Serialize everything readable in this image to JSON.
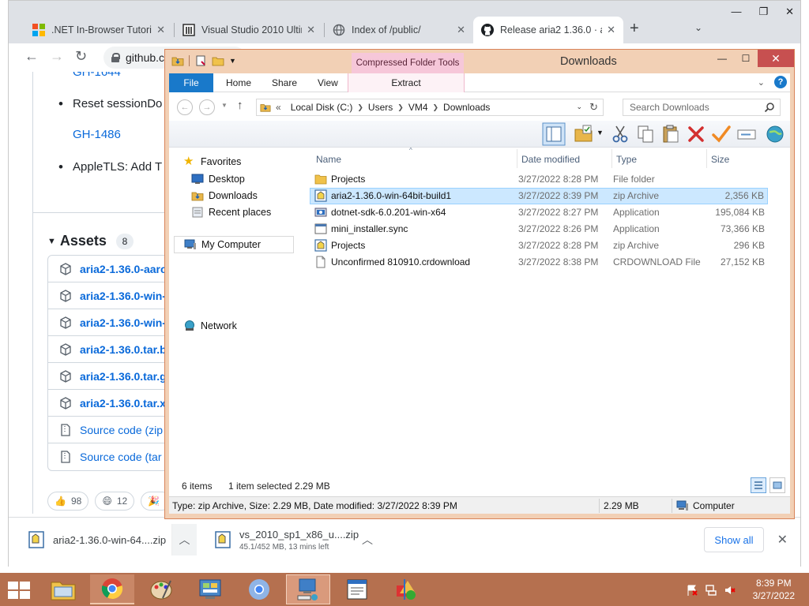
{
  "browser": {
    "tabs": [
      {
        "label": ".NET In-Browser Tutoria",
        "icon": "microsoft-logo"
      },
      {
        "label": "Visual Studio 2010 Ultin",
        "icon": "archive-logo"
      },
      {
        "label": "Index of /public/",
        "icon": "globe-icon"
      },
      {
        "label": "Release aria2 1.36.0 · ar",
        "icon": "github-logo"
      }
    ],
    "omnibox_text": "github.c",
    "page": {
      "link_top": "GH-1644",
      "bullet1": "Reset sessionDo",
      "link_mid": "GH-1486",
      "bullet2": "AppleTLS: Add T",
      "assets_title": "Assets",
      "assets_count": "8",
      "assets": [
        "aria2-1.36.0-aarc",
        "aria2-1.36.0-win-",
        "aria2-1.36.0-win-",
        "aria2-1.36.0.tar.bz",
        "aria2-1.36.0.tar.gz",
        "aria2-1.36.0.tar.xz",
        "Source code (zip",
        "Source code (tar"
      ],
      "reactions": [
        {
          "emoji": "👍",
          "count": "98"
        },
        {
          "emoji": "😄",
          "count": "12"
        },
        {
          "emoji": "🎉",
          "count": ""
        }
      ]
    },
    "downloads": [
      {
        "name": "aria2-1.36.0-win-64....zip",
        "sub": ""
      },
      {
        "name": "vs_2010_sp1_x86_u....zip",
        "sub": "45.1/452 MB, 13 mins left"
      }
    ],
    "show_all": "Show all"
  },
  "explorer": {
    "title": "Downloads",
    "context_tab": "Compressed Folder Tools",
    "ribbon_tabs": {
      "file": "File",
      "home": "Home",
      "share": "Share",
      "view": "View",
      "extract": "Extract"
    },
    "address": {
      "prefix": "«",
      "crumbs": [
        "Local Disk (C:)",
        "Users",
        "VM4",
        "Downloads"
      ]
    },
    "search_placeholder": "Search Downloads",
    "nav": {
      "favorites": "Favorites",
      "desktop": "Desktop",
      "downloads": "Downloads",
      "recent": "Recent places",
      "computer": "My Computer",
      "network": "Network"
    },
    "columns": {
      "name": "Name",
      "date": "Date modified",
      "type": "Type",
      "size": "Size"
    },
    "files": [
      {
        "name": "Projects",
        "date": "3/27/2022 8:28 PM",
        "type": "File folder",
        "size": "",
        "icon": "folder-icon"
      },
      {
        "name": "aria2-1.36.0-win-64bit-build1",
        "date": "3/27/2022 8:39 PM",
        "type": "zip Archive",
        "size": "2,356 KB",
        "icon": "zip-icon"
      },
      {
        "name": "dotnet-sdk-6.0.201-win-x64",
        "date": "3/27/2022 8:27 PM",
        "type": "Application",
        "size": "195,084 KB",
        "icon": "installer-icon"
      },
      {
        "name": "mini_installer.sync",
        "date": "3/27/2022 8:26 PM",
        "type": "Application",
        "size": "73,366 KB",
        "icon": "app-icon"
      },
      {
        "name": "Projects",
        "date": "3/27/2022 8:28 PM",
        "type": "zip Archive",
        "size": "296 KB",
        "icon": "zip-icon"
      },
      {
        "name": "Unconfirmed 810910.crdownload",
        "date": "3/27/2022 8:38 PM",
        "type": "CRDOWNLOAD File",
        "size": "27,152 KB",
        "icon": "file-icon"
      }
    ],
    "item_count": "6 items",
    "selected": "1 item selected  2.29 MB",
    "statusbar": {
      "details": "Type: zip Archive, Size: 2.29 MB, Date modified: 3/27/2022 8:39 PM",
      "size": "2.29 MB",
      "location": "Computer"
    }
  },
  "taskbar": {
    "time": "8:39 PM",
    "date": "3/27/2022"
  },
  "colors": {
    "explorer_frame": "#f2d0b5",
    "taskbar": "#b5704f",
    "selection": "#cce8ff",
    "link": "#0969da",
    "file_tab": "#1979ca"
  }
}
